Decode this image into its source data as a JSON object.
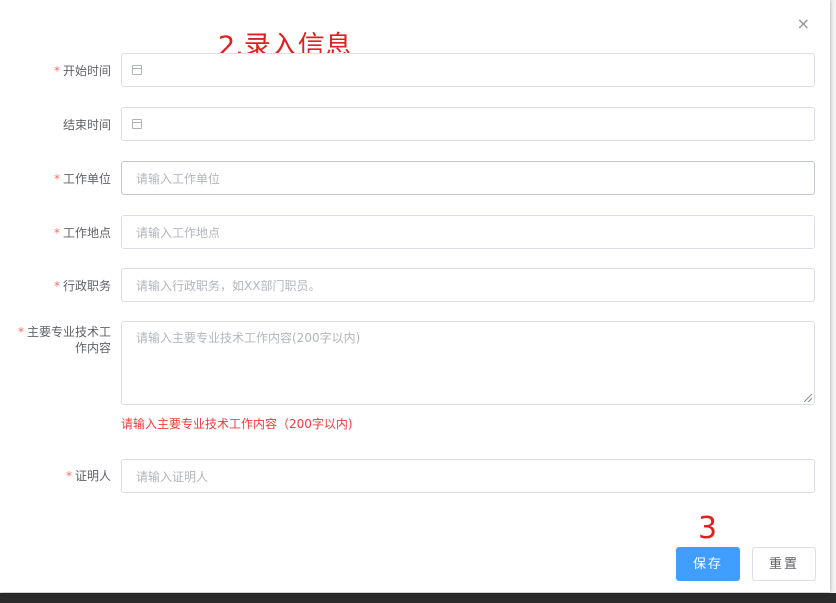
{
  "annotations": {
    "title": "2.录入信息",
    "step3": "3"
  },
  "dialog": {
    "close_icon": "×"
  },
  "form": {
    "start_time": {
      "label": "开始时间",
      "required": "*"
    },
    "end_time": {
      "label": "结束时间"
    },
    "work_unit": {
      "label": "工作单位",
      "required": "*",
      "placeholder": "请输入工作单位"
    },
    "work_location": {
      "label": "工作地点",
      "required": "*",
      "placeholder": "请输入工作地点"
    },
    "admin_position": {
      "label": "行政职务",
      "required": "*",
      "placeholder": "请输入行政职务，如XX部门职员。"
    },
    "main_work": {
      "label": "主要专业技术工作内容",
      "required": "*",
      "placeholder": "请输入主要专业技术工作内容(200字以内)",
      "error": "请输入主要专业技术工作内容（200字以内)"
    },
    "witness": {
      "label": "证明人",
      "required": "*",
      "placeholder": "请输入证明人"
    }
  },
  "buttons": {
    "save": "保存",
    "reset": "重置"
  },
  "icons": {
    "calendar": "calendar-icon",
    "close": "close-icon",
    "resize": "resize-grip-icon"
  },
  "colors": {
    "primary": "#409eff",
    "error": "#f56c6c",
    "annotation": "#e02020"
  }
}
